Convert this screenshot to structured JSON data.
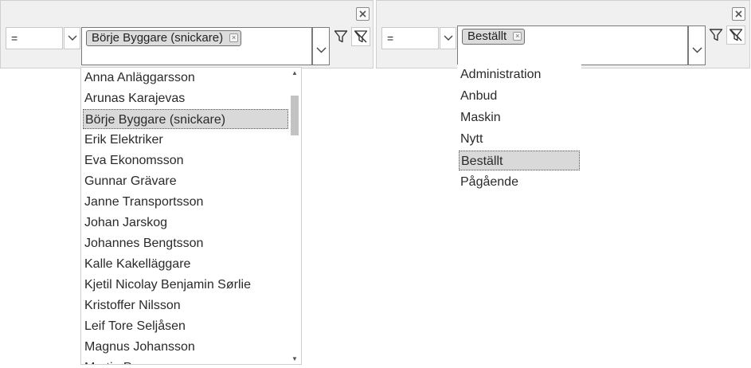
{
  "left_filter": {
    "operator": "=",
    "selected_tag": "Börje Byggare (snickare)",
    "list_items": [
      "Anna Anläggarsson",
      "Arunas Karajevas",
      "Börje Byggare (snickare)",
      "Erik Elektriker",
      "Eva Ekonomsson",
      "Gunnar Grävare",
      "Janne Transportsson",
      "Johan Jarskog",
      "Johannes Bengtsson",
      "Kalle Kakelläggare",
      "Kjetil Nicolay Benjamin Sørlie",
      "Kristoffer Nilsson",
      "Leif Tore Seljåsen",
      "Magnus Johansson",
      "Martin P"
    ],
    "selected_index": 2,
    "scroll_position_fraction": 0.07
  },
  "right_filter": {
    "operator": "=",
    "selected_tag": "Beställt",
    "list_items": [
      "Administration",
      "Anbud",
      "Maskin",
      "Nytt",
      "Beställt",
      "Pågående"
    ],
    "selected_index": 4
  },
  "icons": {
    "close": "close-icon",
    "filter": "filter-icon",
    "clear_filter": "clear-filter-icon",
    "chevron": "chevron-down-icon"
  }
}
